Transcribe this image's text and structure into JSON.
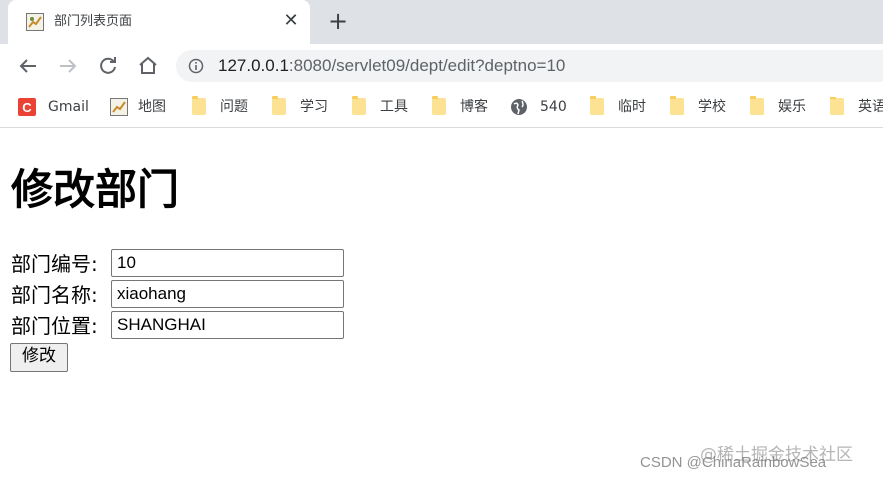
{
  "browser": {
    "tab": {
      "title": "部门列表页面",
      "favicon": "map-favicon-icon",
      "close_icon": "close-icon"
    },
    "new_tab_icon": "plus-icon",
    "toolbar": {
      "back_icon": "back-arrow-icon",
      "forward_icon": "forward-arrow-icon",
      "reload_icon": "reload-icon",
      "home_icon": "home-icon",
      "site_info_icon": "info-icon",
      "url_host": "127.0.0.1",
      "url_rest": ":8080/servlet09/dept/edit?deptno=10"
    },
    "bookmarks": [
      {
        "label": "Gmail",
        "icon": "gmail-icon"
      },
      {
        "label": "地图",
        "icon": "map-icon"
      },
      {
        "label": "问题",
        "icon": "folder-icon"
      },
      {
        "label": "学习",
        "icon": "folder-icon"
      },
      {
        "label": "工具",
        "icon": "folder-icon"
      },
      {
        "label": "博客",
        "icon": "folder-icon"
      },
      {
        "label": "540",
        "icon": "globe-icon"
      },
      {
        "label": "临时",
        "icon": "folder-icon"
      },
      {
        "label": "学校",
        "icon": "folder-icon"
      },
      {
        "label": "娱乐",
        "icon": "folder-icon"
      },
      {
        "label": "英语",
        "icon": "folder-icon"
      }
    ]
  },
  "page": {
    "heading": "修改部门",
    "form": {
      "fields": [
        {
          "label": "部门编号:",
          "value": "10"
        },
        {
          "label": "部门名称:",
          "value": "xiaohang"
        },
        {
          "label": "部门位置:",
          "value": "SHANGHAI"
        }
      ],
      "submit_label": "修改"
    },
    "watermark": {
      "line1": "@稀土掘金技术社区",
      "line2": "CSDN @ChinaRainbowSea"
    }
  }
}
